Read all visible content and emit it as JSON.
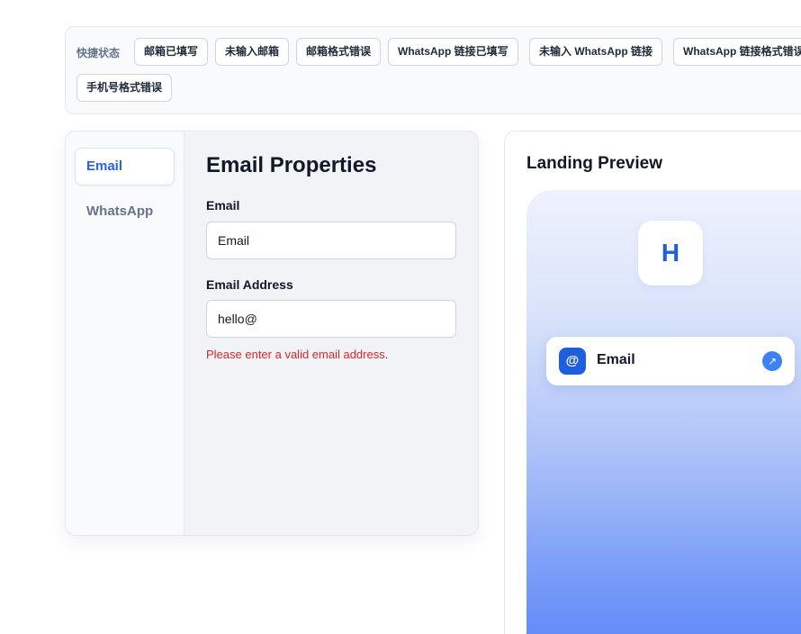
{
  "quick_status": {
    "label": "快捷状态",
    "chips": [
      "邮箱已填写",
      "未输入邮箱",
      "邮箱格式错误",
      "WhatsApp 链接已填写",
      "未输入 WhatsApp 链接",
      "WhatsApp 链接格式错误",
      "手机号格式错误"
    ]
  },
  "editor": {
    "tabs": [
      "Email",
      "WhatsApp"
    ],
    "active_tab": "Email",
    "title": "Email Properties",
    "fields": [
      {
        "label": "Email",
        "value": "Email"
      },
      {
        "label": "Email Address",
        "value": "hello@"
      }
    ],
    "error": "Please enter a valid email address."
  },
  "preview": {
    "title": "Landing Preview",
    "avatar_letter": "H",
    "link": {
      "icon": "at-icon",
      "icon_glyph": "@",
      "label": "Email",
      "arrow_icon": "external-link-icon",
      "arrow_glyph": "↗"
    }
  },
  "colors": {
    "accent": "#2563eb",
    "error": "#dc2626",
    "gradient_top": "#eef2fd",
    "gradient_bottom": "#5b86f7"
  }
}
